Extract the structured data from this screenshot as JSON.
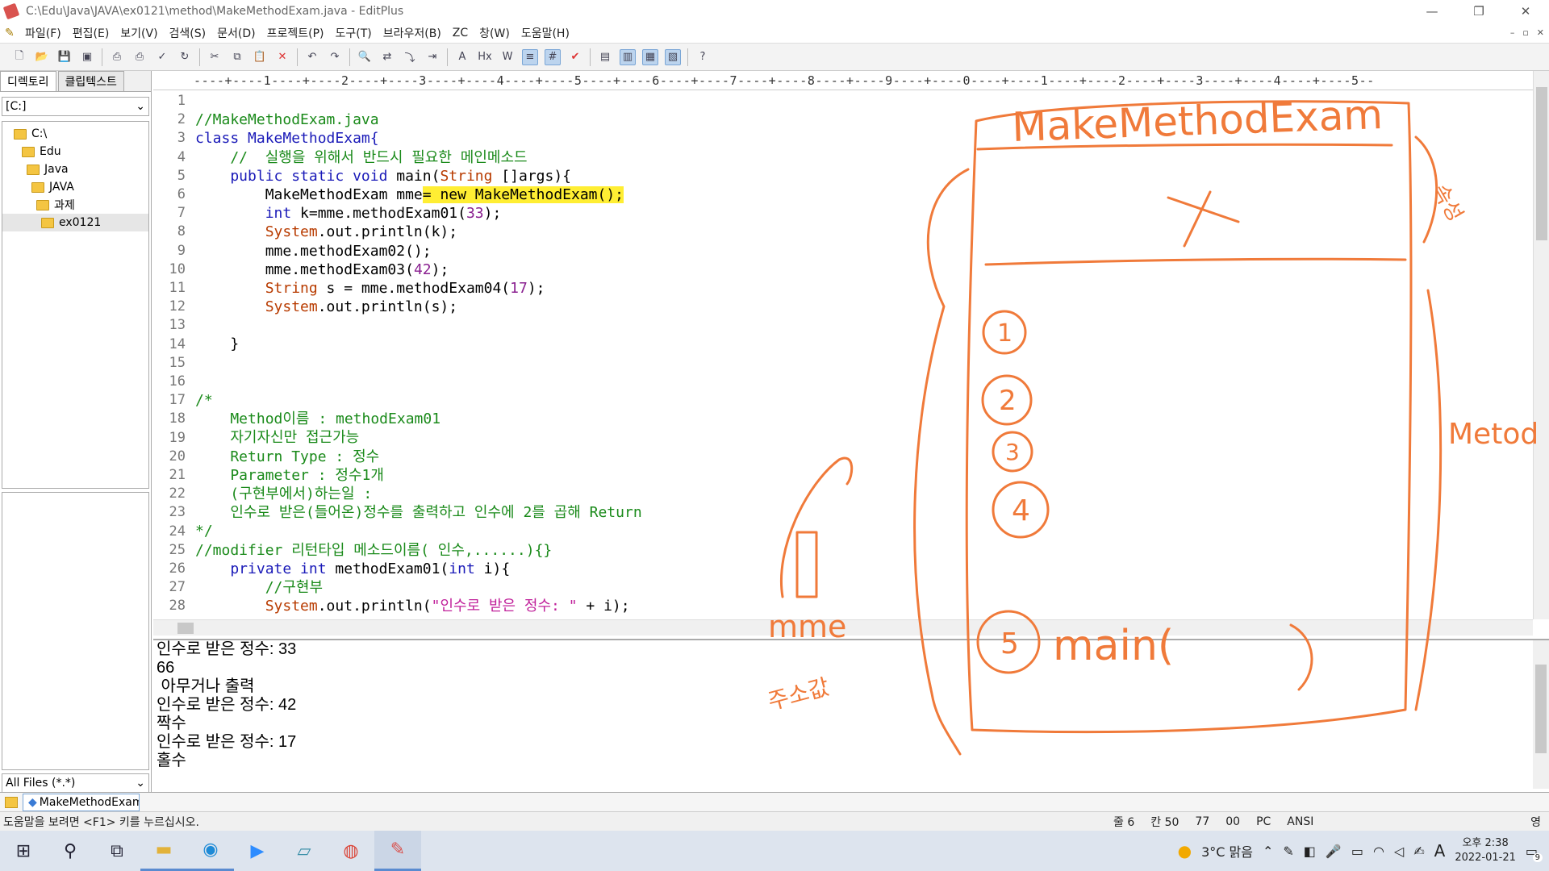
{
  "window": {
    "title": "C:\\Edu\\Java\\JAVA\\ex0121\\method\\MakeMethodExam.java - EditPlus",
    "minimize": "—",
    "restore": "❐",
    "close": "✕"
  },
  "menu": [
    "파일(F)",
    "편집(E)",
    "보기(V)",
    "검색(S)",
    "문서(D)",
    "프로젝트(P)",
    "도구(T)",
    "브라우저(B)",
    "ZC",
    "창(W)",
    "도움말(H)"
  ],
  "toolbar_icons": [
    "new-file-icon",
    "open-icon",
    "save-icon",
    "save-all-icon",
    "print-preview-icon",
    "print-icon",
    "spellcheck-icon",
    "refresh-icon",
    "cut-icon",
    "copy-icon",
    "paste-icon",
    "delete-icon",
    "undo-icon",
    "redo-icon",
    "find-icon",
    "replace-icon",
    "goto-icon",
    "indent-icon",
    "font-icon",
    "hex-icon",
    "word-wrap-icon",
    "line-number-icon",
    "ruler-icon",
    "check-icon",
    "browser-icon",
    "directory-icon",
    "cliptext-icon",
    "output-icon",
    "help-icon"
  ],
  "left_panel": {
    "tabs": [
      "디렉토리",
      "클립텍스트"
    ],
    "drive": "[C:]",
    "tree": [
      "C:\\",
      "Edu",
      "Java",
      "JAVA",
      "과제",
      "ex0121"
    ],
    "filter": "All Files (*.*)"
  },
  "ruler": "----+----1----+----2----+----3----+----4----+----5----+----6----+----7----+----8----+----9----+----0----+----1----+----2----+----3----+----4----+----5--",
  "code_lines": [
    [],
    [
      {
        "t": "//MakeMethodExam.java",
        "c": "c-cmt"
      }
    ],
    [
      {
        "t": "class MakeMethodExam{",
        "c": "c-kw"
      }
    ],
    [
      {
        "t": "    //  실행을 위해서 반드시 필요한 메인메소드",
        "c": "c-cmt"
      }
    ],
    [
      {
        "t": "    public static void ",
        "c": "c-kw"
      },
      {
        "t": "main("
      },
      {
        "t": "String",
        "c": "c-typ"
      },
      {
        "t": " []args){"
      }
    ],
    [
      {
        "t": "        MakeMethodExam mme"
      },
      {
        "t": "= new MakeMethodExam();",
        "c": "hl"
      }
    ],
    [
      {
        "t": "        int ",
        "c": "c-kw"
      },
      {
        "t": "k=mme.methodExam01("
      },
      {
        "t": "33",
        "c": "c-num"
      },
      {
        "t": ");"
      }
    ],
    [
      {
        "t": "        System",
        "c": "c-typ"
      },
      {
        "t": ".out.println(k);"
      }
    ],
    [
      {
        "t": "        mme.methodExam02();"
      }
    ],
    [
      {
        "t": "        mme.methodExam03("
      },
      {
        "t": "42",
        "c": "c-num"
      },
      {
        "t": ");"
      }
    ],
    [
      {
        "t": "        String",
        "c": "c-typ"
      },
      {
        "t": " s = mme.methodExam04("
      },
      {
        "t": "17",
        "c": "c-num"
      },
      {
        "t": ");"
      }
    ],
    [
      {
        "t": "        System",
        "c": "c-typ"
      },
      {
        "t": ".out.println(s);"
      }
    ],
    [],
    [
      {
        "t": "    }"
      }
    ],
    [],
    [],
    [
      {
        "t": "/*",
        "c": "c-cmt"
      }
    ],
    [
      {
        "t": "    Method이름 : methodExam01",
        "c": "c-cmt"
      }
    ],
    [
      {
        "t": "    자기자신만 접근가능",
        "c": "c-cmt"
      }
    ],
    [
      {
        "t": "    Return Type : 정수",
        "c": "c-cmt"
      }
    ],
    [
      {
        "t": "    Parameter : 정수1개",
        "c": "c-cmt"
      }
    ],
    [
      {
        "t": "    (구현부에서)하는일 :",
        "c": "c-cmt"
      }
    ],
    [
      {
        "t": "    인수로 받은(들어온)정수를 출력하고 인수에 2를 곱해 Return",
        "c": "c-cmt"
      }
    ],
    [
      {
        "t": "*/",
        "c": "c-cmt"
      }
    ],
    [
      {
        "t": "//modifier 리턴타입 메소드이름( 인수,......){}",
        "c": "c-cmt"
      }
    ],
    [
      {
        "t": "    private int ",
        "c": "c-kw"
      },
      {
        "t": "methodExam01("
      },
      {
        "t": "int ",
        "c": "c-kw"
      },
      {
        "t": "i){"
      }
    ],
    [
      {
        "t": "        //구현부",
        "c": "c-cmt"
      }
    ],
    [
      {
        "t": "        System",
        "c": "c-typ"
      },
      {
        "t": ".out.println("
      },
      {
        "t": "\"인수로 받은 정수: \"",
        "c": "c-str"
      },
      {
        "t": " + i);"
      }
    ]
  ],
  "output_lines": [
    "인수로 받은 정수: 33",
    "66",
    " 아무거나 출력",
    "인수로 받은 정수: 42",
    "짝수",
    "인수로 받은 정수: 17",
    "홀수"
  ],
  "doc_tab": "MakeMethodExam.java",
  "status": {
    "help": "도움말을 보려면 <F1> 키를 누르십시오.",
    "line": "줄 6",
    "col": "칸 50",
    "total": "77",
    "n": "00",
    "mode": "PC",
    "encoding": "ANSI",
    "ime": "영"
  },
  "taskbar": {
    "weather": "3°C  맑음",
    "time": "오후 2:38",
    "date": "2022-01-21",
    "ime": "A",
    "notifications": "9"
  },
  "annotations": {
    "box_title": "MakeMethodExam",
    "main_label": "main(",
    "method_label": "Metod",
    "mme_label": "mme",
    "side_note_top": "속성",
    "side_note_bottom": "주소값"
  },
  "colors": {
    "ink": "#f07a3a",
    "highlight": "#ffee33",
    "comment": "#1a8a1a",
    "keyword": "#1a1ab8"
  }
}
